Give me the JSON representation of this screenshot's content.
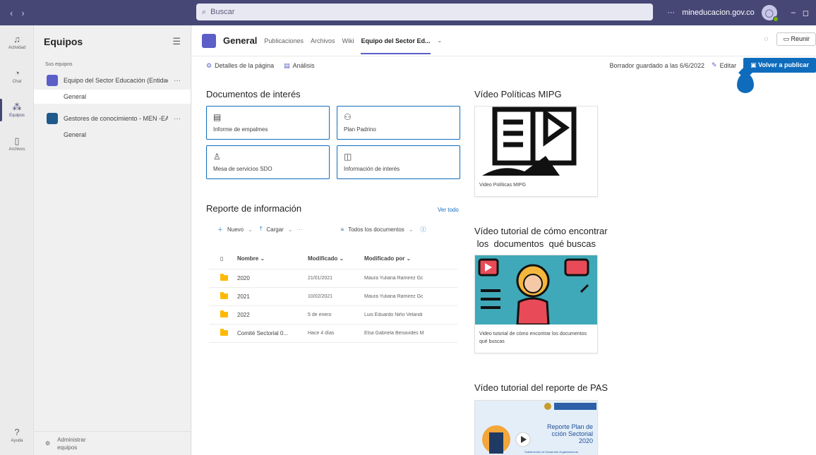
{
  "titlebar": {
    "search_placeholder": "Buscar",
    "more": "···",
    "org": "mineducacion.gov.co",
    "minimize": "–",
    "restore": "◻"
  },
  "appbar": {
    "items": [
      {
        "label": "Actividad",
        "icon": "bell-icon"
      },
      {
        "label": "Chat",
        "icon": "chat-icon"
      },
      {
        "label": "Equipos",
        "icon": "teams-icon"
      },
      {
        "label": "Archivos",
        "icon": "file-icon"
      }
    ],
    "help_label": "Ayuda"
  },
  "teams_panel": {
    "title": "Equipos",
    "section_label": "Sus equipos",
    "teams": [
      {
        "name": "Equipo del Sector Educación (Entidad...",
        "channel": "General",
        "color": "#5b5fc7"
      },
      {
        "name": "Gestores de conocimiento - MEN -EAV",
        "channel": "General",
        "color": "#1f5a8b"
      }
    ],
    "more": "···",
    "manage_line1": "Administrar",
    "manage_line2": "equipos"
  },
  "channel_header": {
    "title": "General",
    "tabs": [
      "Publicaciones",
      "Archivos",
      "Wiki",
      "Equipo del Sector Ed..."
    ],
    "meet_label": "Reunir"
  },
  "command_bar": {
    "page_details": "Detalles de la página",
    "analytics": "Análisis",
    "draft_status": "Borrador guardado a las 6/6/2022",
    "edit": "Editar",
    "republish": "Volver a publicar"
  },
  "documents_section": {
    "title": "Documentos de interés",
    "links": [
      {
        "label": "Informe de empalmes",
        "icon": "document-icon"
      },
      {
        "label": "Plan Padrino",
        "icon": "people-icon"
      },
      {
        "label": "Mesa de servicios SDO",
        "icon": "person-icon"
      },
      {
        "label": "Información de interés",
        "icon": "image-icon"
      }
    ]
  },
  "report_section": {
    "title": "Reporte de información",
    "see_all": "Ver todo",
    "new_label": "Nuevo",
    "upload_label": "Cargar",
    "more": "···",
    "view_label": "Todos los documentos",
    "columns": {
      "name": "Nombre",
      "modified": "Modificado",
      "modified_by": "Modificado por"
    },
    "rows": [
      {
        "name": "2020",
        "modified": "21/01/2021",
        "modified_by": "Maura Yuliana Ramirez Gc"
      },
      {
        "name": "2021",
        "modified": "10/02/2021",
        "modified_by": "Maura Yuliana Ramirez Gc"
      },
      {
        "name": "2022",
        "modified": "5 de enero",
        "modified_by": "Luis Eduardo Niño Velandi"
      },
      {
        "name": "Comité Sectorial 0...",
        "modified": "Hace 4 días",
        "modified_by": "Elsa Gabriela Benavides M"
      }
    ]
  },
  "videos": [
    {
      "title": "Vídeo Políticas MIPG",
      "caption": "Video Políticas MIPG"
    },
    {
      "title_line1": "Vídeo tutorial de cómo encontrar",
      "title_line2": " los  documentos  qué buscas",
      "caption": "Video tutorial de cómo encontrar los documentos qué buscas"
    },
    {
      "title": "Vídeo tutorial del reporte de PAS",
      "thumb_line1": "Reporte Plan de",
      "thumb_line2": "cción Sectorial",
      "thumb_line3": "2020",
      "thumb_footer": "Subdirección de Desarrollo Organizacional"
    }
  ]
}
